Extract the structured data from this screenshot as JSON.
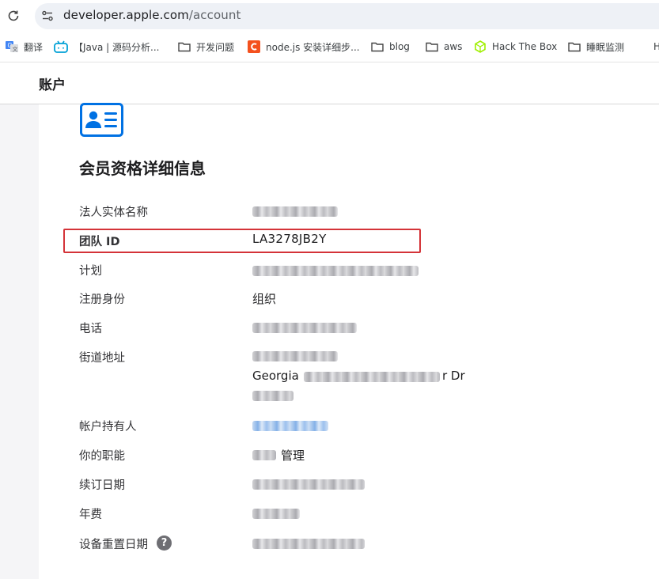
{
  "browser": {
    "url_host": "developer.apple.com",
    "url_path": "/account",
    "bookmarks": [
      {
        "label": "翻译",
        "icon": "translate-icon"
      },
      {
        "label": "【Java | 源码分析...",
        "icon": "bilibili-icon"
      },
      {
        "label": "开发问题",
        "icon": "folder-icon"
      },
      {
        "label": "node.js 安装详细步...",
        "icon": "c-logo-icon"
      },
      {
        "label": "blog",
        "icon": "folder-icon"
      },
      {
        "label": "aws",
        "icon": "folder-icon"
      },
      {
        "label": "Hack The Box",
        "icon": "hackthebox-icon"
      },
      {
        "label": "睡眠监测",
        "icon": "folder-icon"
      },
      {
        "label": "H",
        "icon": ""
      }
    ]
  },
  "header": {
    "title": "账户"
  },
  "membership": {
    "section_title": "会员资格详细信息",
    "fields": {
      "entity_name_label": "法人实体名称",
      "team_id_label": "团队 ID",
      "team_id_value": "LA3278JB2Y",
      "program_label": "计划",
      "enrolled_as_label": "注册身份",
      "enrolled_as_value": "组织",
      "phone_label": "电话",
      "address_label": "街道地址",
      "address_partial": "Georgia",
      "address_partial_end": "r Dr",
      "holder_label": "帐户持有人",
      "role_label": "你的职能",
      "role_partial": "管理",
      "renewal_label": "续订日期",
      "fee_label": "年费",
      "device_reset_label": "设备重置日期",
      "help_glyph": "?"
    }
  },
  "colors": {
    "highlight_border": "#d43338",
    "apple_blue": "#0071e3",
    "gutter": "#f5f5f7"
  }
}
